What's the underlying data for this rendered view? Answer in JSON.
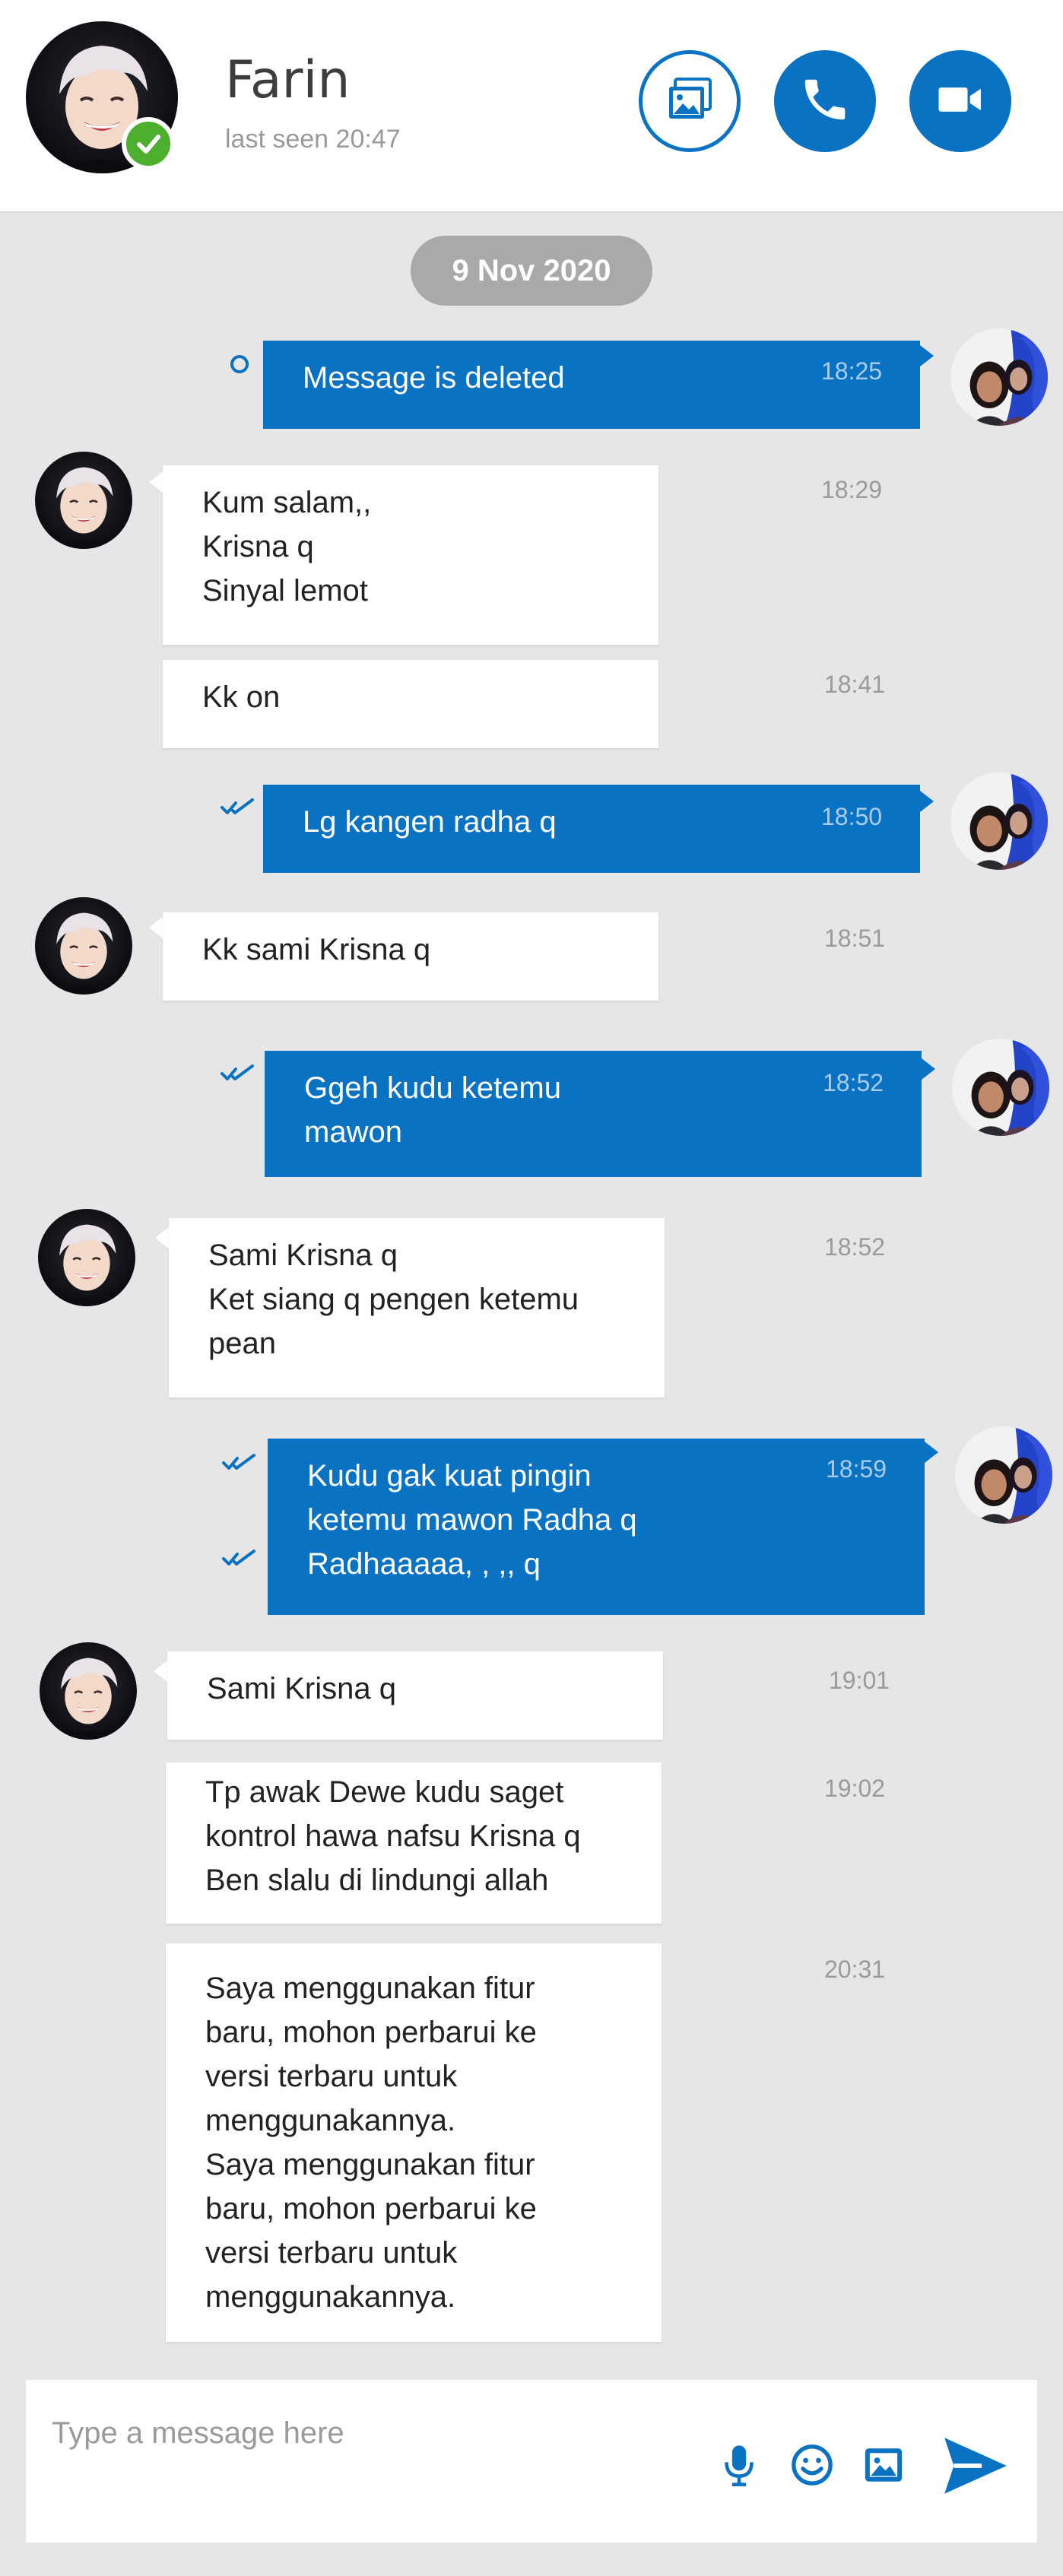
{
  "colors": {
    "accent": "#0a72c2",
    "online": "#4caf2e",
    "background": "#e6e6e6",
    "date_pill": "#a9a9a9"
  },
  "header": {
    "contact_name": "Farin",
    "last_seen": "last seen 20:47",
    "icons": [
      "gallery-icon",
      "phone-icon",
      "video-camera-icon"
    ]
  },
  "date_separator": "9 Nov 2020",
  "messages": [
    {
      "dir": "out",
      "time": "18:25",
      "status": "pending",
      "lines": [
        "Message is deleted"
      ]
    },
    {
      "dir": "in",
      "time": "18:29",
      "lines": [
        "Kum salam,,",
        "Krisna q",
        "Sinyal lemot"
      ]
    },
    {
      "dir": "in",
      "time": "18:41",
      "lines": [
        "Kk on"
      ]
    },
    {
      "dir": "out",
      "time": "18:50",
      "status": "read",
      "lines": [
        "Lg kangen radha q"
      ]
    },
    {
      "dir": "in",
      "time": "18:51",
      "lines": [
        "Kk sami Krisna q"
      ]
    },
    {
      "dir": "out",
      "time": "18:52",
      "status": "read",
      "lines": [
        "Ggeh kudu ketemu",
        "mawon"
      ]
    },
    {
      "dir": "in",
      "time": "18:52",
      "lines": [
        "Sami Krisna q",
        "Ket siang q pengen ketemu",
        "pean"
      ]
    },
    {
      "dir": "out",
      "time": "18:59",
      "status": "read",
      "lines": [
        "Kudu gak kuat pingin",
        "ketemu mawon Radha q",
        "Radhaaaaa, , ,, q"
      ]
    },
    {
      "dir": "in",
      "time": "19:01",
      "lines": [
        "Sami Krisna q"
      ]
    },
    {
      "dir": "in",
      "time": "19:02",
      "lines": [
        "Tp awak Dewe kudu saget",
        "kontrol hawa nafsu Krisna q",
        "Ben slalu di lindungi allah"
      ]
    },
    {
      "dir": "in",
      "time": "20:31",
      "lines": [
        "Saya menggunakan fitur",
        "baru, mohon perbarui ke",
        "versi terbaru untuk",
        "menggunakannya.",
        "Saya menggunakan fitur",
        "baru, mohon perbarui ke",
        "versi terbaru untuk",
        "menggunakannya."
      ]
    }
  ],
  "composer": {
    "placeholder": "Type a message here",
    "icons": [
      "microphone-icon",
      "emoji-icon",
      "image-icon",
      "send-icon"
    ]
  }
}
